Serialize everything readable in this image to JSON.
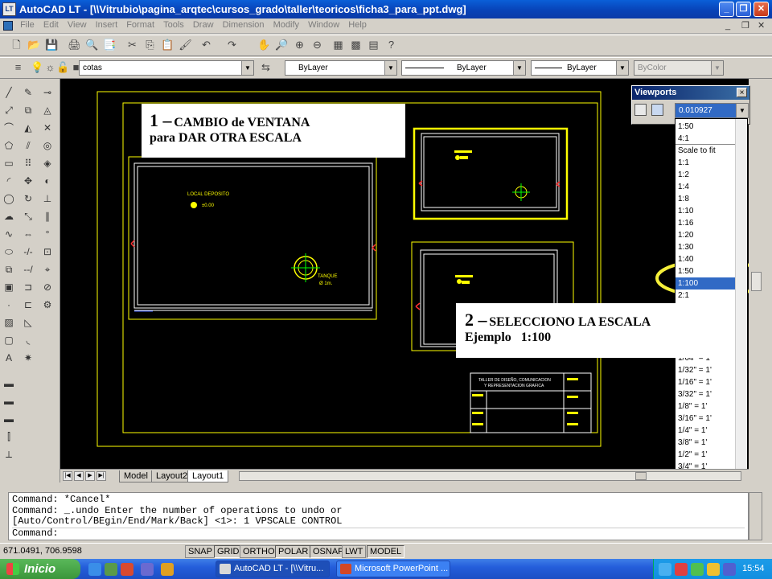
{
  "window": {
    "title": "AutoCAD LT - [\\\\Vitrubio\\pagina_arqtec\\cursos_grado\\taller\\teoricos\\ficha3_para_ppt.dwg]",
    "app_icon_label": "LT"
  },
  "menu": [
    "File",
    "Edit",
    "View",
    "Insert",
    "Format",
    "Tools",
    "Draw",
    "Dimension",
    "Modify",
    "Window",
    "Help"
  ],
  "layers_toolbar": {
    "layer_name": "cotas",
    "color": "ByLayer",
    "linetype": "ByLayer",
    "lineweight": "ByLayer",
    "plotstyle": "ByColor"
  },
  "viewports": {
    "title": "Viewports",
    "scale_value": "0.010927",
    "close_glyph": "×"
  },
  "scale_list": {
    "items": [
      "1:50",
      "4:1",
      "Scale to fit",
      "1:1",
      "1:2",
      "1:4",
      "1:8",
      "1:10",
      "1:16",
      "1:20",
      "1:30",
      "1:40",
      "1:50",
      "1:100",
      "2:1"
    ],
    "items_lower": [
      "1/64\" = 1'",
      "1/32\" = 1'",
      "1/16\" = 1'",
      "3/32\" = 1'",
      "1/8\" = 1'",
      "3/16\" = 1'",
      "1/4\" = 1'",
      "3/8\" = 1'",
      "1/2\" = 1'",
      "3/4\" = 1'"
    ],
    "selected": "1:100"
  },
  "callout_1": {
    "number": "1 –",
    "line1": "CAMBIO de VENTANA",
    "line2": "para DAR OTRA ESCALA"
  },
  "callout_2": {
    "number": "2 –",
    "line1": "SELECCIONO LA ESCALA",
    "line2": "Ejemplo   1:100"
  },
  "drawing": {
    "room_label": "LOCAL DEPOSITO",
    "level_label": "±0.00",
    "tank_label": "TANQUE",
    "tank_sub": "Ø 1m.",
    "title_block_line1": "TALLER DE DISEÑO, COMUNICACION",
    "title_block_line2": "Y REPRESENTACION GRAFICA"
  },
  "tabs": {
    "items": [
      "Model",
      "Layout2",
      "Layout1"
    ],
    "active": "Layout1"
  },
  "command_lines": [
    "Command: *Cancel*",
    "Command: _.undo Enter the number of operations to undo or",
    "[Auto/Control/BEgin/End/Mark/Back] <1>: 1 VPSCALE CONTROL",
    "Command:"
  ],
  "status": {
    "coords": "671.0491, 706.9598",
    "buttons": [
      "SNAP",
      "GRID",
      "ORTHO",
      "POLAR",
      "OSNAP",
      "LWT",
      "MODEL"
    ]
  },
  "taskbar": {
    "start_label": "Inicio",
    "tasks": [
      "AutoCAD LT - [\\\\Vitru...",
      "Microsoft PowerPoint ..."
    ],
    "time": "15:54"
  },
  "colors": {
    "title_blue": "#0843b8",
    "drawing_bg": "#000000",
    "highlight": "#ffff00",
    "select_blue": "#316ac5",
    "start_green": "#3a963a"
  }
}
